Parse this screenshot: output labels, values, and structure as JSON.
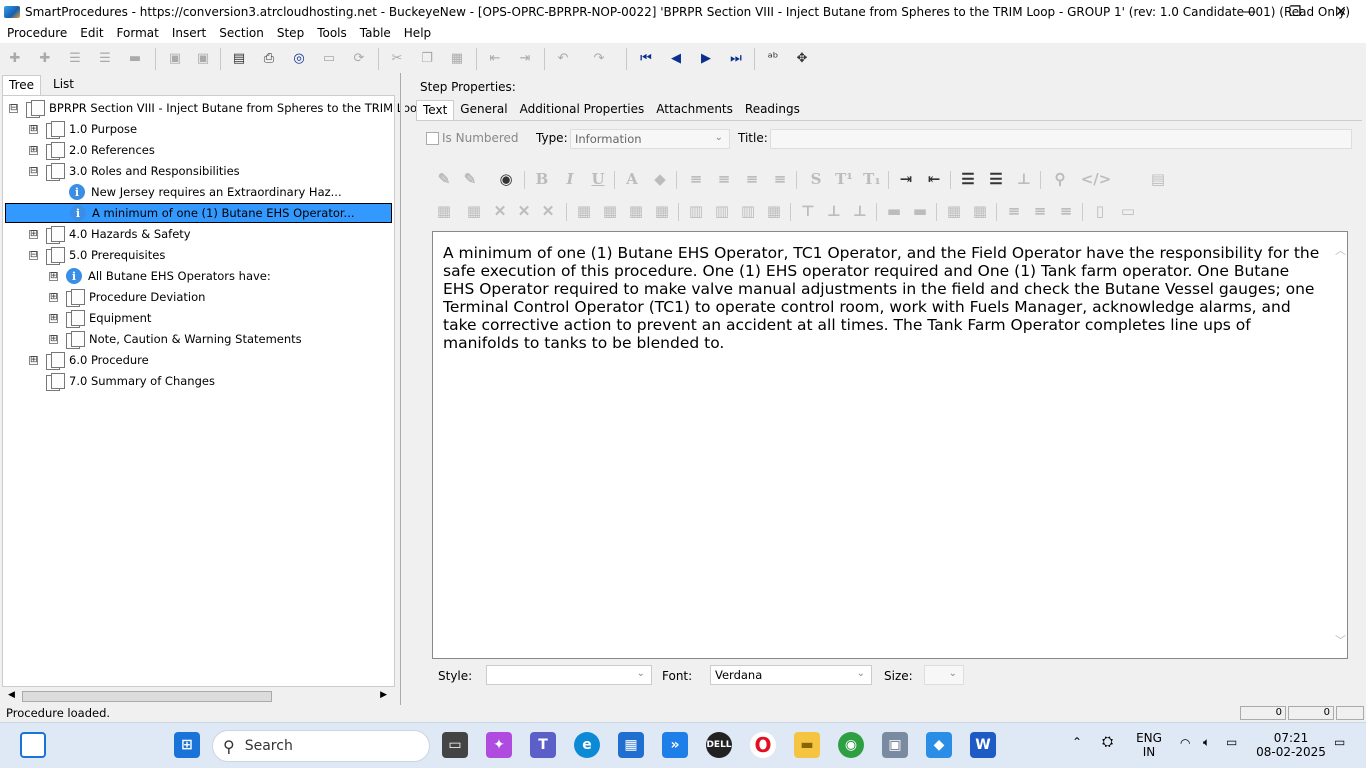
{
  "window": {
    "title": "SmartProcedures - https://conversion3.atrcloudhosting.net - BuckeyeNew - [OPS-OPRC-BPRPR-NOP-0022] 'BPRPR Section VIII - Inject Butane from Spheres to the TRIM Loop - GROUP 1' (rev: 1.0 Candidate 001) (Read Only)",
    "minimize": "—",
    "maximize": "❐",
    "close": "✕"
  },
  "menu": [
    "Procedure",
    "Edit",
    "Format",
    "Insert",
    "Section",
    "Step",
    "Tools",
    "Table",
    "Help"
  ],
  "left_tabs": [
    "Tree",
    "List"
  ],
  "tree": [
    {
      "label": "BPRPR Section VIII - Inject Butane from Spheres to the TRIM Loo...",
      "expander": "⊟",
      "icon": "doc"
    },
    {
      "label": "1.0 Purpose",
      "expander": "⊞",
      "icon": "doc"
    },
    {
      "label": "2.0 References",
      "expander": "⊞",
      "icon": "doc"
    },
    {
      "label": "3.0 Roles and Responsibilities",
      "expander": "⊟",
      "icon": "doc"
    },
    {
      "label": "New Jersey requires an Extraordinary Haz...",
      "expander": "",
      "icon": "info"
    },
    {
      "label": "A minimum of one (1) Butane EHS Operator...",
      "expander": "",
      "icon": "info"
    },
    {
      "label": "4.0 Hazards & Safety",
      "expander": "⊞",
      "icon": "doc"
    },
    {
      "label": "5.0 Prerequisites",
      "expander": "⊟",
      "icon": "doc"
    },
    {
      "label": "All Butane EHS Operators have:",
      "expander": "⊞",
      "icon": "info"
    },
    {
      "label": "Procedure Deviation",
      "expander": "⊞",
      "icon": "doc"
    },
    {
      "label": "Equipment",
      "expander": "⊞",
      "icon": "doc"
    },
    {
      "label": "Note, Caution & Warning Statements",
      "expander": "⊞",
      "icon": "doc"
    },
    {
      "label": "6.0 Procedure",
      "expander": "⊞",
      "icon": "doc"
    },
    {
      "label": "7.0 Summary of Changes",
      "expander": "",
      "icon": "doc"
    }
  ],
  "step_properties": {
    "heading": "Step Properties:",
    "tabs": [
      "Text",
      "General",
      "Additional Properties",
      "Attachments",
      "Readings"
    ],
    "is_numbered_label": "Is Numbered",
    "type_label": "Type:",
    "type_value": "Information",
    "title_label": "Title:",
    "title_value": "",
    "body_text": "A minimum of one (1) Butane EHS Operator, TC1 Operator, and the Field Operator have the responsibility for the safe execution of this procedure. One (1) EHS operator required and One (1) Tank farm operator. One Butane EHS Operator required to make valve manual adjustments in the field and check the Butane Vessel gauges; one Terminal Control Operator (TC1) to operate control room, work with Fuels Manager, acknowledge alarms, and take corrective action to prevent an accident at all times. The Tank Farm Operator completes line ups of manifolds to tanks to be blended to.",
    "style_label": "Style:",
    "style_value": "",
    "font_label": "Font:",
    "font_value": "Verdana",
    "size_label": "Size:",
    "size_value": ""
  },
  "status": {
    "message": "Procedure loaded.",
    "cell1": "0",
    "cell2": "0"
  },
  "taskbar": {
    "search_placeholder": "Search",
    "language": "ENG",
    "region": "IN",
    "time": "07:21",
    "date": "08-02-2025"
  }
}
